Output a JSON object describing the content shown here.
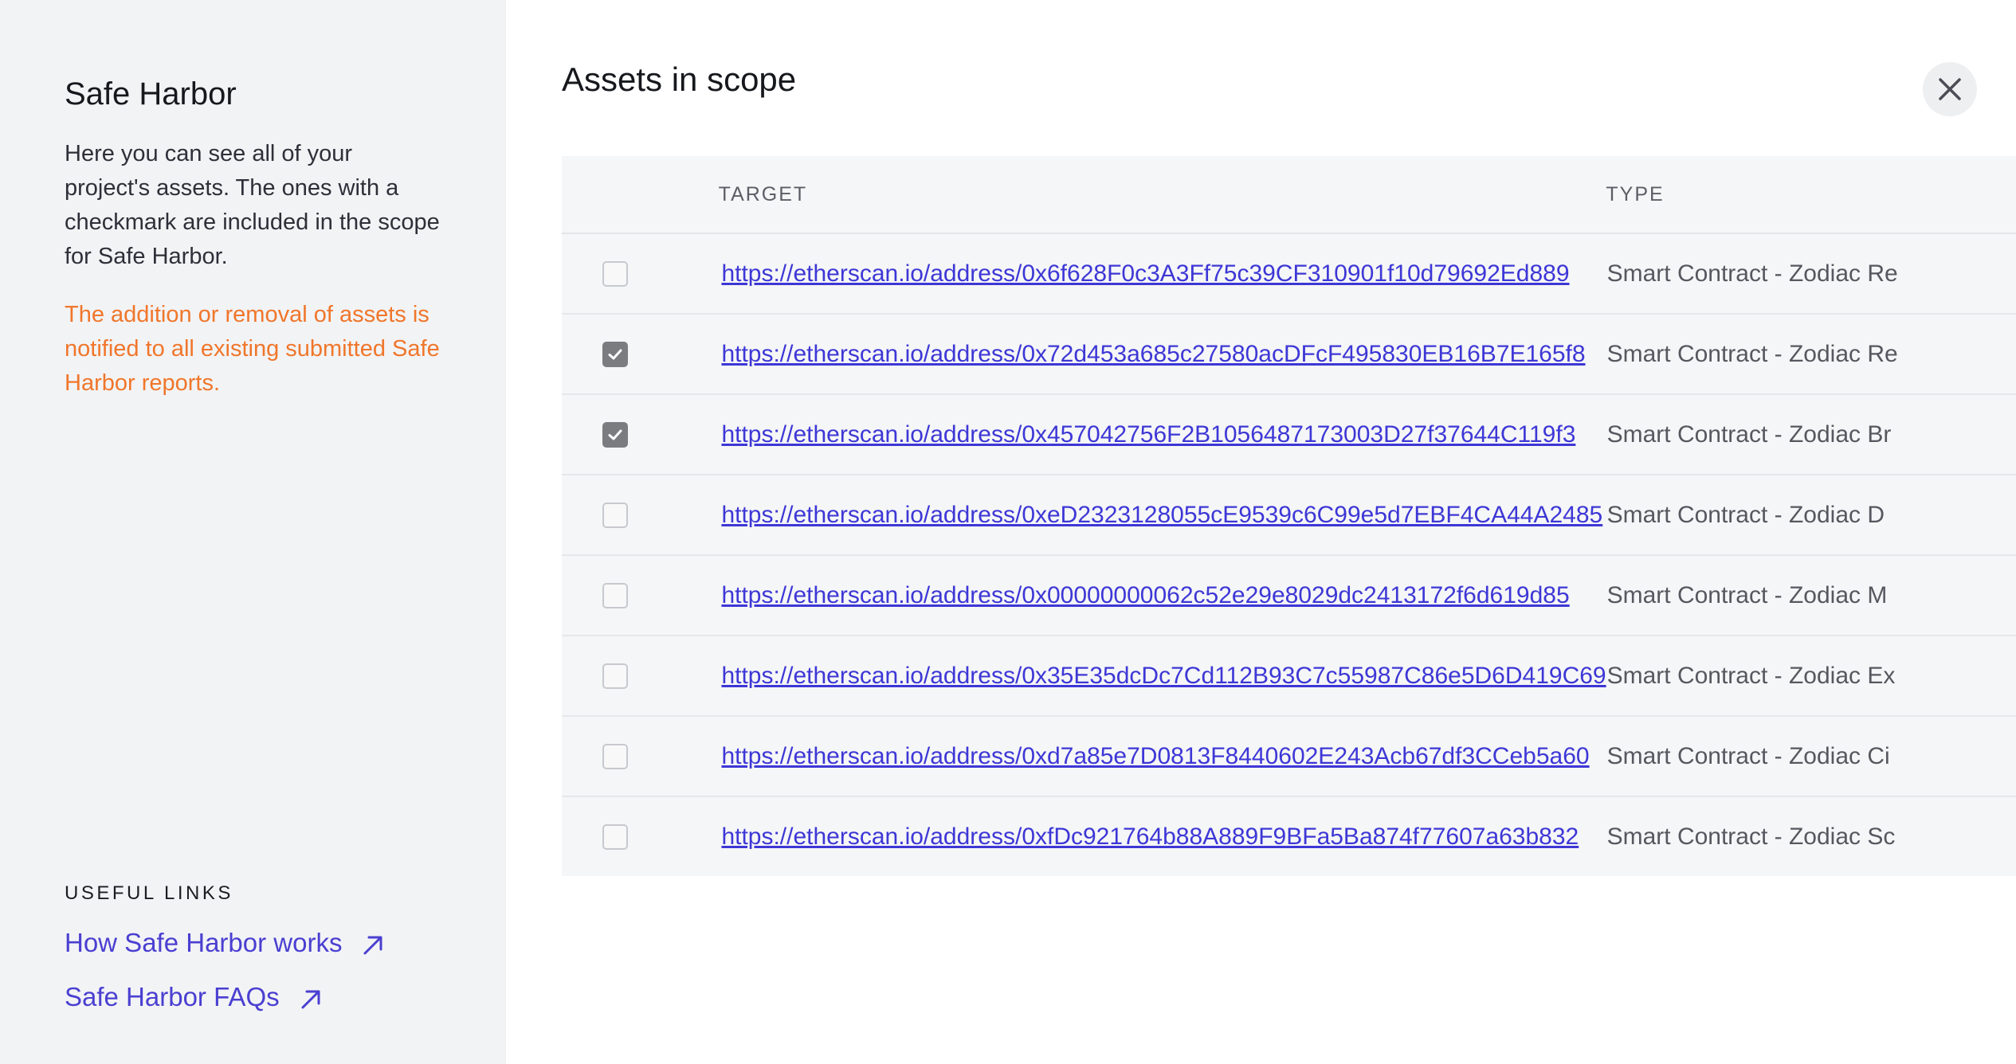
{
  "sidebar": {
    "title": "Safe Harbor",
    "description": "Here you can see all of your project's assets. The ones with a checkmark are included in the scope for Safe Harbor.",
    "warning": "The addition or removal of assets is notified to all existing submitted Safe Harbor reports.",
    "warning_color": "#f0762b",
    "useful_links_heading": "USEFUL LINKS",
    "links": [
      {
        "label": "How Safe Harbor works",
        "icon": "external-arrow-icon"
      },
      {
        "label": "Safe Harbor FAQs",
        "icon": "external-arrow-icon"
      }
    ]
  },
  "main": {
    "title": "Assets in scope",
    "close_icon": "close-icon",
    "table": {
      "columns": [
        "TARGET",
        "TYPE"
      ],
      "rows": [
        {
          "checked": false,
          "target": "https://etherscan.io/address/0x6f628F0c3A3Ff75c39CF310901f10d79692Ed889",
          "type": "Smart Contract - Zodiac Re"
        },
        {
          "checked": true,
          "target": "https://etherscan.io/address/0x72d453a685c27580acDFcF495830EB16B7E165f8",
          "type": "Smart Contract - Zodiac Re"
        },
        {
          "checked": true,
          "target": "https://etherscan.io/address/0x457042756F2B1056487173003D27f37644C119f3",
          "type": "Smart Contract - Zodiac Br"
        },
        {
          "checked": false,
          "target": "https://etherscan.io/address/0xeD2323128055cE9539c6C99e5d7EBF4CA44A2485",
          "type": "Smart Contract - Zodiac D"
        },
        {
          "checked": false,
          "target": "https://etherscan.io/address/0x00000000062c52e29e8029dc2413172f6d619d85",
          "type": "Smart Contract - Zodiac M"
        },
        {
          "checked": false,
          "target": "https://etherscan.io/address/0x35E35dcDc7Cd112B93C7c55987C86e5D6D419C69",
          "type": "Smart Contract - Zodiac Ex"
        },
        {
          "checked": false,
          "target": "https://etherscan.io/address/0xd7a85e7D0813F8440602E243Acb67df3CCeb5a60",
          "type": "Smart Contract - Zodiac Ci"
        },
        {
          "checked": false,
          "target": "https://etherscan.io/address/0xfDc921764b88A889F9BFa5Ba874f77607a63b832",
          "type": "Smart Contract - Zodiac Sc"
        }
      ]
    },
    "link_color": "#3d37d6"
  }
}
